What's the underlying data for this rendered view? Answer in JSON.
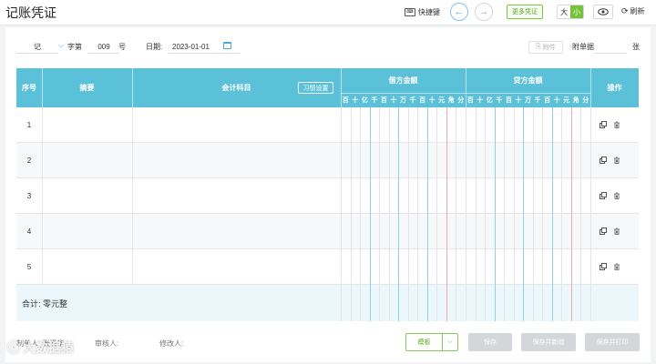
{
  "header": {
    "title": "记账凭证",
    "shortcut_label": "快捷键",
    "more_button": "更多凭证",
    "size_big": "大",
    "size_small": "小",
    "refresh_label": "刷新"
  },
  "form": {
    "voucher_word": "记",
    "zidi_label": "字第",
    "voucher_number": "009",
    "hao_label": "号",
    "date_label": "日期:",
    "date_value": "2023-01-01",
    "attachment_button": "附件",
    "docs_label": "附单据",
    "docs_value": "",
    "zhang_label": "张"
  },
  "table": {
    "headers": {
      "seq": "序号",
      "summary": "摘要",
      "account": "会计科目",
      "habit_button": "习惯设置",
      "debit": "借方金额",
      "credit": "贷方金额",
      "ops": "操作"
    },
    "digit_units": [
      "百",
      "十",
      "亿",
      "千",
      "百",
      "十",
      "万",
      "千",
      "百",
      "十",
      "元",
      "角",
      "分"
    ],
    "rows": [
      {
        "num": "1",
        "summary": "",
        "account": ""
      },
      {
        "num": "2",
        "summary": "",
        "account": ""
      },
      {
        "num": "3",
        "summary": "",
        "account": ""
      },
      {
        "num": "4",
        "summary": "",
        "account": ""
      },
      {
        "num": "5",
        "summary": "",
        "account": ""
      }
    ],
    "total_label": "合计: 零元整"
  },
  "footer": {
    "creator": "制单人: 张泽华",
    "reviewer": "审核人:",
    "modifier": "修改人:",
    "template_button": "模板",
    "save_button": "保存",
    "save_new_button": "保存并新增",
    "save_print_button": "保存并打印"
  },
  "watermark": "大数据猿",
  "colors": {
    "header_bg": "#5bc1d8",
    "accent_green": "#76c33a",
    "total_bg": "#ecf7fc"
  }
}
